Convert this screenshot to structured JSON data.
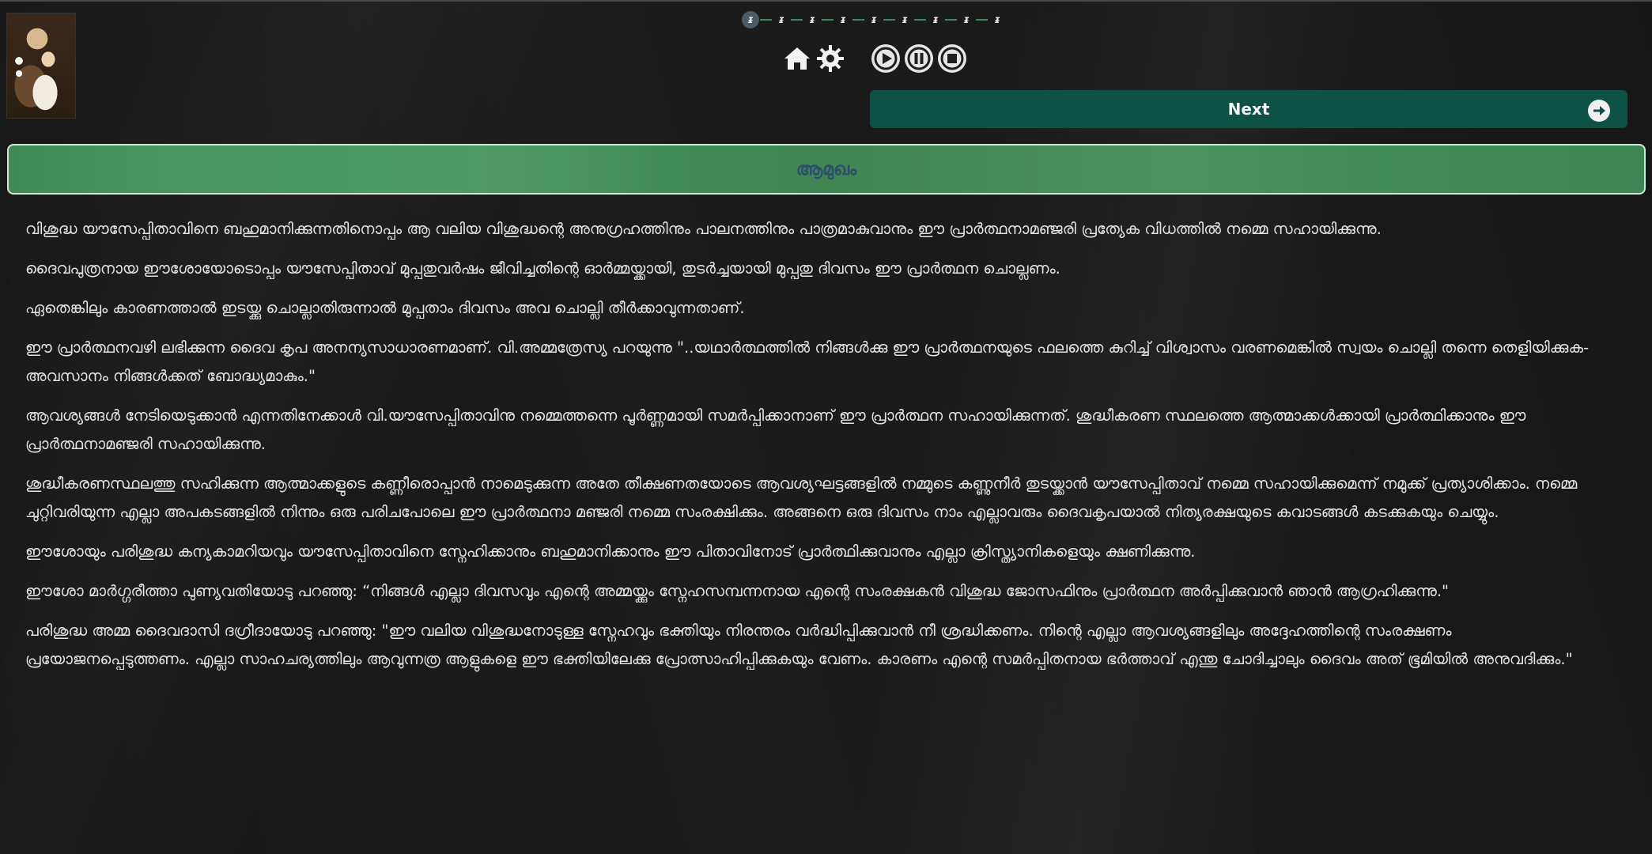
{
  "pager": {
    "items": [
      "ᵻ",
      "ᵻ",
      "ᵻ",
      "ᵻ",
      "ᵻ",
      "ᵻ",
      "ᵻ",
      "ᵻ",
      "ᵻ"
    ],
    "active_index": 0
  },
  "toolbar": {
    "icons": [
      "home-icon",
      "settings-gear-icon",
      "play-icon",
      "pause-icon",
      "stop-icon"
    ]
  },
  "next_button": {
    "label": "Next",
    "icon": "arrow-right-circle-icon"
  },
  "section": {
    "title": "ആമുഖം"
  },
  "colors": {
    "next_button_bg": "#0e5145",
    "section_bar": "#4a9a62",
    "section_title": "#2e4f6a",
    "body_text": "#e4e4e4",
    "background": "#1e1e1e"
  },
  "paragraphs": [
    "വിശുദ്ധ യൗസേപ്പിതാവിനെ ബഹുമാനിക്കുന്നതിനൊപ്പം ആ വലിയ വിശുദ്ധന്റെ അനുഗ്രഹത്തിനും പാലനത്തിനും പാത്രമാകുവാനും ഈ പ്രാർത്ഥനാമഞ്ജരി പ്രത്യേക വിധത്തിൽ നമ്മെ സഹായിക്കുന്നു.",
    "ദൈവപുത്രനായ ഈശോയോടൊപ്പം യൗസേപ്പിതാവ് മുപ്പതുവർഷം ജീവിച്ചതിന്റെ ഓർമ്മയ്ക്കായി,  തുടർച്ചയായി മുപ്പതു ദിവസം ഈ പ്രാർത്ഥന ചൊല്ലണം.",
    "ഏതെങ്കിലും കാരണത്താൽ ഇടയ്ക്കു ചൊല്ലാതിരുന്നാൽ മുപ്പതാം ദിവസം അവ ചൊല്ലി തീർക്കാവുന്നതാണ്.",
    "ഈ പ്രാർത്ഥനവഴി ലഭിക്കുന്ന ദൈവ കൃപ അനന്യസാധാരണമാണ്. വി.അമ്മത്രേസ്യ പറയുന്നു \"..യഥാർത്ഥത്തിൽ നിങ്ങൾക്കു ഈ പ്രാർത്ഥനയുടെ  ഫലത്തെ കുറിച്ച്  വിശ്വാസം വരണമെങ്കിൽ സ്വയം ചൊല്ലി തന്നെ തെളിയിക്കുക- അവസാനം നിങ്ങൾക്കത് ബോദ്ധ്യമാകും.\"",
    "ആവശ്യങ്ങൾ നേടിയെടുക്കാൻ എന്നതിനേക്കാൾ വി.യൗസേപ്പിതാവിനു  നമ്മെത്തന്നെ പൂർണ്ണമായി സമർപ്പിക്കാനാണ് ഈ പ്രാർത്ഥന സഹായിക്കുന്നത്. ശുദ്ധീകരണ സ്ഥലത്തെ ആത്മാക്കൾക്കായി പ്രാർത്ഥിക്കാനും ഈ പ്രാർത്ഥനാമഞ്ജരി സഹായിക്കുന്നു.",
    "ശുദ്ധീകരണസ്ഥലത്തു സഹിക്കുന്ന ആത്മാക്കളുടെ കണ്ണീരൊപ്പാൻ നാമെടുക്കുന്ന  അതേ തീക്ഷണതയോടെ ആവശ്യഘട്ടങ്ങളിൽ നമ്മുടെ കണ്ണുനീർ തുടയ്ക്കാൻ യൗസേപ്പിതാവ് നമ്മെ സഹായിക്കുമെന്ന് നമുക്ക് പ്രത്യാശിക്കാം. നമ്മെ ചുറ്റിവരിയുന്ന എല്ലാ അപകടങ്ങളിൽ നിന്നും ഒരു പരിചപോലെ ഈ പ്രാർത്ഥനാ മഞ്ജരി നമ്മെ സംരക്ഷിക്കും. അങ്ങനെ ഒരു ദിവസം നാം എല്ലാവരും ദൈവകൃപയാൽ നിത്യരക്ഷയുടെ കവാടങ്ങൾ കടക്കുകയും ചെയ്യും.",
    "ഈശോയും പരിശുദ്ധ കന്യകാമറിയവും യൗസേപ്പിതാവിനെ സ്നേഹിക്കാനും ബഹുമാനിക്കാനും ഈ പിതാവിനോട് പ്രാർത്ഥിക്കുവാനും എല്ലാ ക്രിസ്ത്യാനികളെയും ക്ഷണിക്കുന്നു.",
    "ഈശോ മാർഗ്ഗരീത്താ പുണ്യവതിയോടു പറഞ്ഞു: “നിങ്ങൾ എല്ലാ ദിവസവും എന്റെ അമ്മയ്ക്കും സ്നേഹസമ്പന്നനായ എന്റെ  സംരക്ഷകൻ വിശുദ്ധ ജോസഫിനും പ്രാർത്ഥന അർപ്പിക്കുവാൻ ഞാൻ ആഗ്രഹിക്കുന്നു.\"",
    "പരിശുദ്ധ അമ്മ ദൈവദാസി ദഗ്രീദായോടു പറഞ്ഞു: \"ഈ വലിയ വിശുദ്ധനോടുള്ള സ്നേഹവും ഭക്തിയും നിരന്തരം വർദ്ധിപ്പിക്കുവാൻ  നീ ശ്രദ്ധിക്കണം. നിന്റെ എല്ലാ ആവശ്യങ്ങളിലും അദ്ദേഹത്തിന്റെ സംരക്ഷണം പ്രയോജനപ്പെടുത്തണം. എല്ലാ സാഹചര്യത്തിലും ആവുന്നത്ര ആളുകളെ ഈ ഭക്തിയിലേക്കു പ്രോത്സാഹിപ്പിക്കുകയും വേണം. കാരണം എന്റെ സമർപ്പിതനായ ഭർത്താവ് എന്തു ചോദിച്ചാലും ദൈവം അത് ഭൂമിയിൽ അനുവദിക്കും.\""
  ]
}
